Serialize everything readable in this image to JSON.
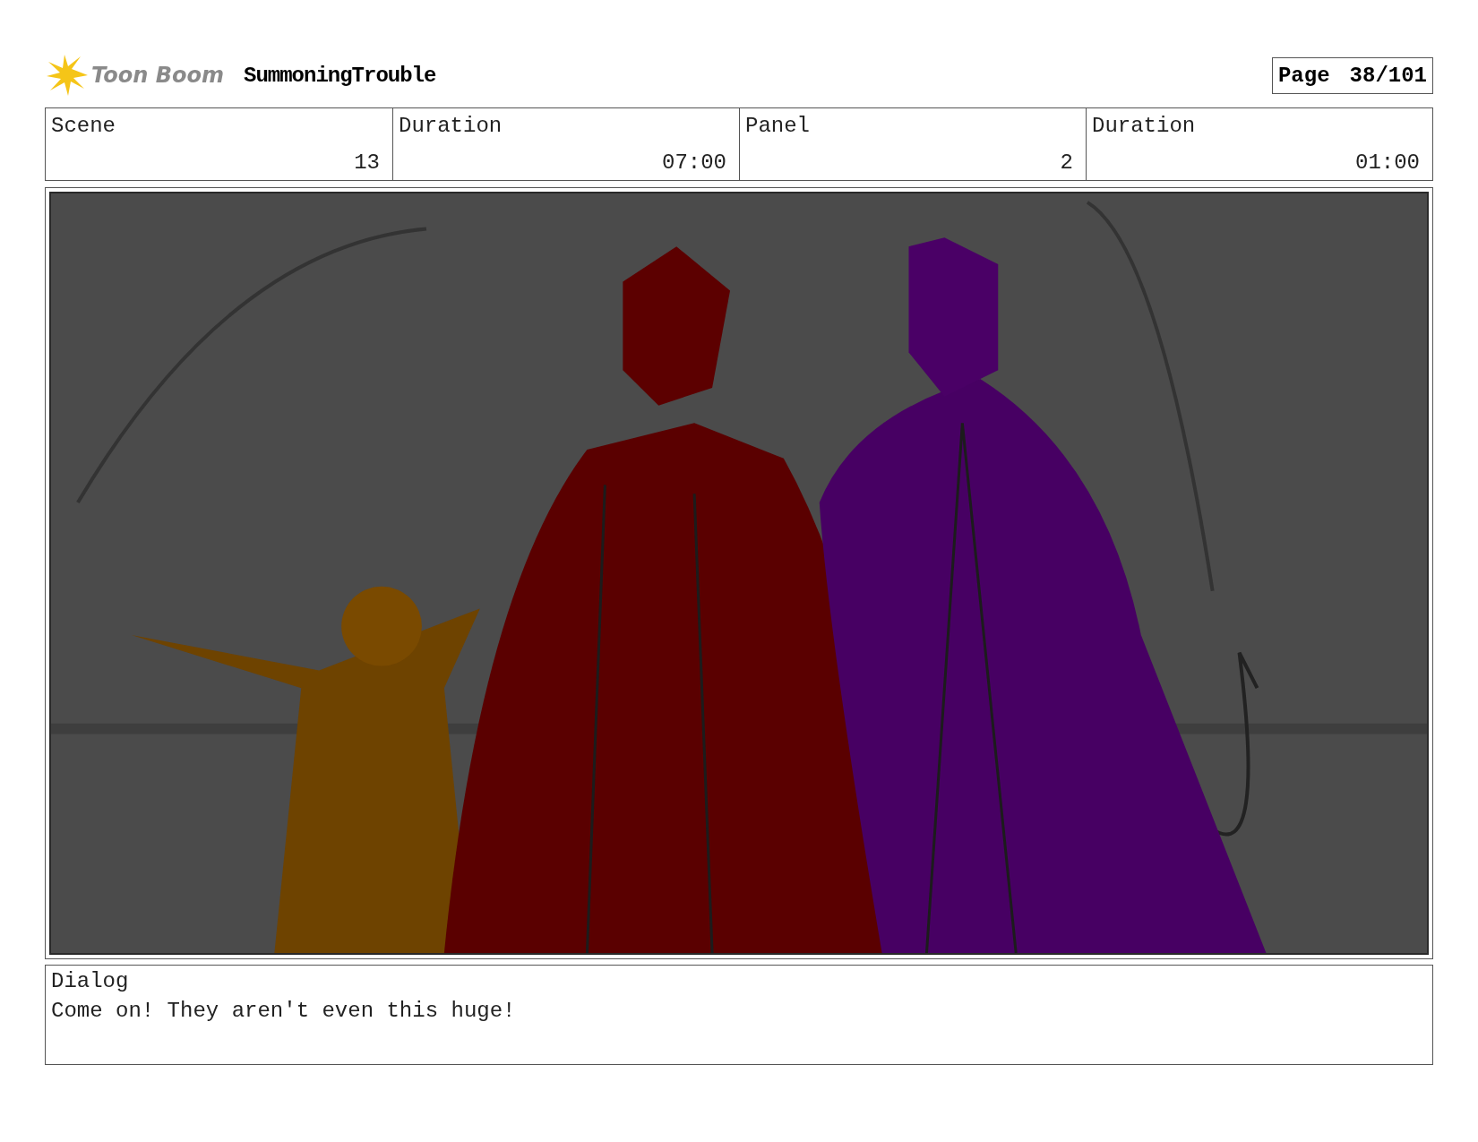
{
  "header": {
    "logo_text": "Toon Boom",
    "project_title": "SummoningTrouble",
    "page_label": "Page",
    "page_number": "38/101"
  },
  "info_cells": [
    {
      "label": "Scene",
      "value": "13"
    },
    {
      "label": "Duration",
      "value": "07:00"
    },
    {
      "label": "Panel",
      "value": "2"
    },
    {
      "label": "Duration",
      "value": "01:00"
    }
  ],
  "dialog": {
    "label": "Dialog",
    "text": "Come on! They aren't even this huge!"
  }
}
